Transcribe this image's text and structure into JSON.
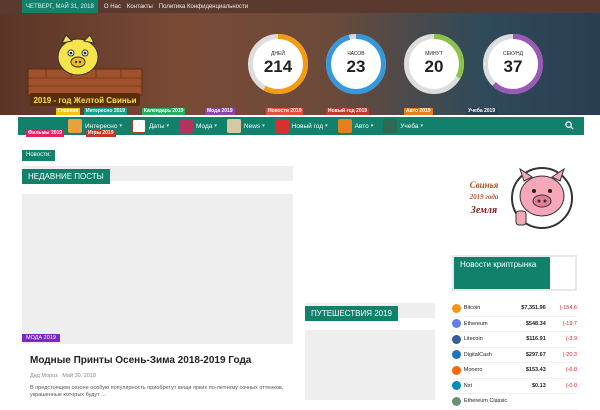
{
  "topbar": {
    "date": "Четверг, май 31, 2018",
    "links": [
      "О Нас",
      "Контакты",
      "Политика Конфиденциальности"
    ]
  },
  "logo": {
    "text": "2019 - год Желтой Свиньи"
  },
  "countdown": [
    {
      "label": "Дней",
      "value": "214",
      "color": "#f39c12",
      "fraction": 0.58
    },
    {
      "label": "Часов",
      "value": "23",
      "color": "#3498db",
      "fraction": 0.96
    },
    {
      "label": "Минут",
      "value": "20",
      "color": "#8bc34a",
      "fraction": 0.33
    },
    {
      "label": "Секунд",
      "value": "37",
      "color": "#9b59b6",
      "fraction": 0.62
    }
  ],
  "cat_labels": [
    {
      "text": "Главная",
      "color": "#f1c40f"
    },
    {
      "text": "Интересно 2019",
      "color": "#16a085"
    },
    {
      "text": "Календарь 2019",
      "color": "#27ae60"
    },
    {
      "text": "Мода 2019",
      "color": "#8e44ad"
    },
    {
      "text": "Новости 2019",
      "color": "#e74c3c"
    },
    {
      "text": "Новый год 2019",
      "color": "#c0392b"
    },
    {
      "text": "Авто 2019",
      "color": "#e67e22"
    },
    {
      "text": "Учеба 2019",
      "color": "#2c3e50"
    },
    {
      "text": "Фильмы 2019",
      "color": "#e91e63"
    },
    {
      "text": "Игры 2019",
      "color": "#c0392b"
    }
  ],
  "nav": {
    "items": [
      "Интересно",
      "Даты",
      "Мода",
      "News",
      "Новый год",
      "Авто",
      "Учеба"
    ],
    "search_icon": "search-icon"
  },
  "ticker": {
    "label": "Новости:"
  },
  "recent": {
    "title": "Недавние посты"
  },
  "featured": {
    "tag": "Мода 2019",
    "title": "Модные Принты Осень-Зима 2018-2019 Года",
    "author": "Дед Мороз",
    "date": "Май 30, 2018",
    "excerpt": "В предстоящем сезоне особую популярность приобретут вещи ярких по-летнему сочных оттенков, украшенные которых будут ..."
  },
  "travel": {
    "title": "Путешествия 2019"
  },
  "ad": {
    "line1": "Свинья",
    "line2": "2019 года",
    "line3": "Земля"
  },
  "crypto": {
    "title": "Новости криптрынка",
    "rows": [
      {
        "name": "Bitcoin",
        "price": "$7,351.96",
        "change": "(-154.6",
        "color": "#f7931a"
      },
      {
        "name": "Ethereum",
        "price": "$548.34",
        "change": "(-19.7",
        "color": "#627eea"
      },
      {
        "name": "Litecoin",
        "price": "$116.91",
        "change": "(-3.9",
        "color": "#345d9d"
      },
      {
        "name": "DigitalCash",
        "price": "$297.67",
        "change": "(-20.3",
        "color": "#1c75bc"
      },
      {
        "name": "Monero",
        "price": "$153.43",
        "change": "(-6.0",
        "color": "#ff6600"
      },
      {
        "name": "Nxt",
        "price": "$0.13",
        "change": "(-0.0",
        "color": "#008fbb"
      },
      {
        "name": "Ethereum Classic",
        "price": "",
        "change": "",
        "color": "#669073"
      }
    ]
  }
}
